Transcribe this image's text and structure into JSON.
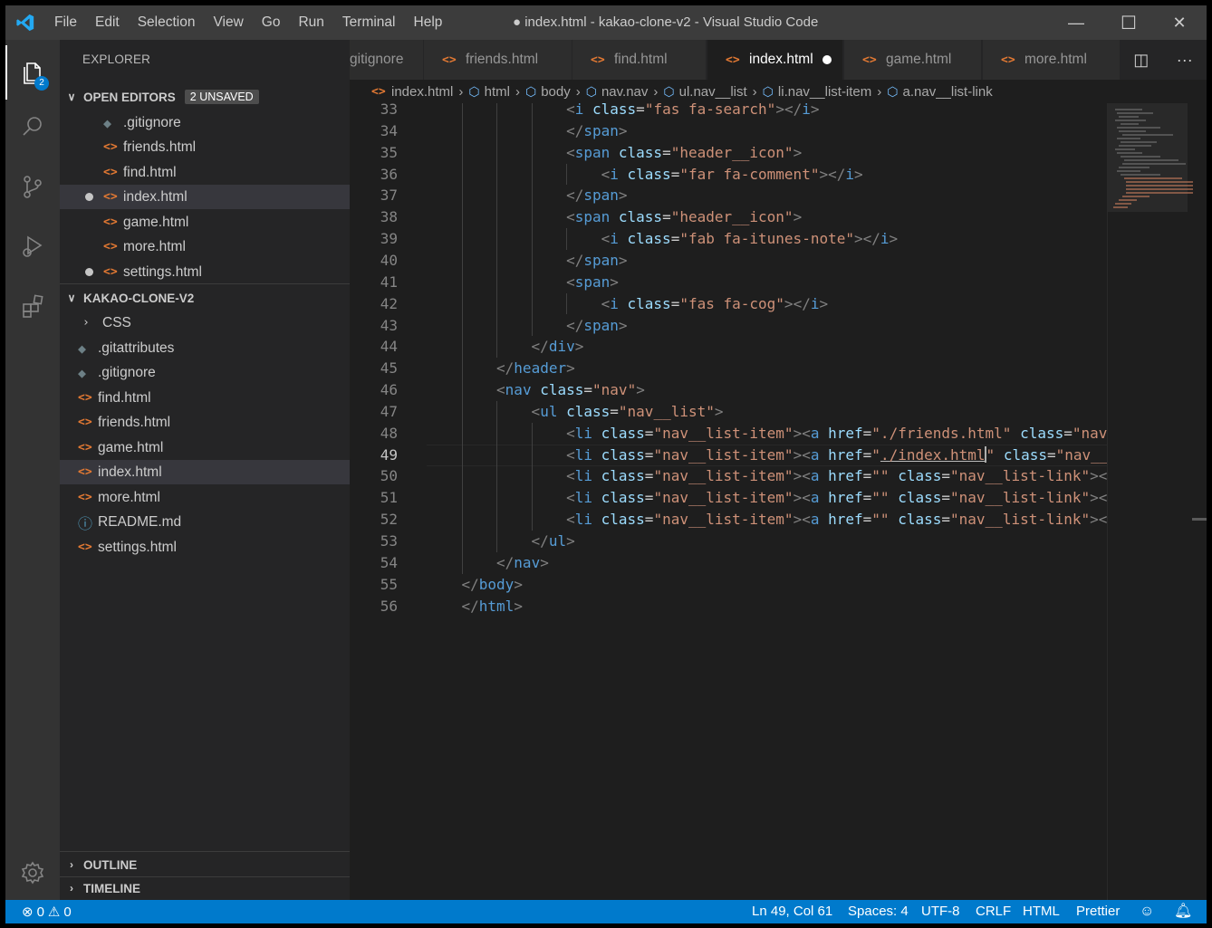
{
  "window": {
    "title": "● index.html - kakao-clone-v2 - Visual Studio Code",
    "minimize": "—",
    "maximize": "☐",
    "close": "✕"
  },
  "menu": [
    "File",
    "Edit",
    "Selection",
    "View",
    "Go",
    "Run",
    "Terminal",
    "Help"
  ],
  "activity": {
    "explorer_badge": "2",
    "icons": [
      "files-icon",
      "search-icon",
      "source-control-icon",
      "run-debug-icon",
      "extensions-icon",
      "settings-gear-icon"
    ]
  },
  "sidebar": {
    "title": "EXPLORER",
    "open_editors": {
      "label": "OPEN EDITORS",
      "badge": "2 UNSAVED",
      "items": [
        {
          "name": ".gitignore",
          "icon": "git-icon",
          "dirty": false
        },
        {
          "name": "friends.html",
          "icon": "html-icon",
          "dirty": false
        },
        {
          "name": "find.html",
          "icon": "html-icon",
          "dirty": false
        },
        {
          "name": "index.html",
          "icon": "html-icon",
          "dirty": true,
          "selected": true
        },
        {
          "name": "game.html",
          "icon": "html-icon",
          "dirty": false
        },
        {
          "name": "more.html",
          "icon": "html-icon",
          "dirty": false
        },
        {
          "name": "settings.html",
          "icon": "html-icon",
          "dirty": true
        }
      ]
    },
    "project": {
      "label": "KAKAO-CLONE-V2",
      "items": [
        {
          "name": "CSS",
          "icon": "folder-chevron-icon"
        },
        {
          "name": ".gitattributes",
          "icon": "git-icon"
        },
        {
          "name": ".gitignore",
          "icon": "git-icon"
        },
        {
          "name": "find.html",
          "icon": "html-icon"
        },
        {
          "name": "friends.html",
          "icon": "html-icon"
        },
        {
          "name": "game.html",
          "icon": "html-icon"
        },
        {
          "name": "index.html",
          "icon": "html-icon",
          "selected": true
        },
        {
          "name": "more.html",
          "icon": "html-icon"
        },
        {
          "name": "README.md",
          "icon": "info-icon"
        },
        {
          "name": "settings.html",
          "icon": "html-icon"
        }
      ]
    },
    "outline": "OUTLINE",
    "timeline": "TIMELINE"
  },
  "tabs": [
    {
      "label": "gitignore",
      "icon": "git-icon",
      "active": false
    },
    {
      "label": "friends.html",
      "icon": "html-icon",
      "active": false
    },
    {
      "label": "find.html",
      "icon": "html-icon",
      "active": false
    },
    {
      "label": "index.html",
      "icon": "html-icon",
      "active": true,
      "dirty": true
    },
    {
      "label": "game.html",
      "icon": "html-icon",
      "active": false
    },
    {
      "label": "more.html",
      "icon": "html-icon",
      "active": false
    }
  ],
  "breadcrumb": [
    "index.html",
    "html",
    "body",
    "nav.nav",
    "ul.nav__list",
    "li.nav__list-item",
    "a.nav__list-link"
  ],
  "editor": {
    "lines": [
      {
        "n": "33",
        "code": "<i class=\"fas fa-search\"></i>"
      },
      {
        "n": "34",
        "code": "</span>"
      },
      {
        "n": "35",
        "code": "<span class=\"header__icon\">"
      },
      {
        "n": "36",
        "code": "<i class=\"far fa-comment\"></i>"
      },
      {
        "n": "37",
        "code": "</span>"
      },
      {
        "n": "38",
        "code": "<span class=\"header__icon\">"
      },
      {
        "n": "39",
        "code": "<i class=\"fab fa-itunes-note\"></i>"
      },
      {
        "n": "40",
        "code": "</span>"
      },
      {
        "n": "41",
        "code": "<span>"
      },
      {
        "n": "42",
        "code": "<i class=\"fas fa-cog\"></i>"
      },
      {
        "n": "43",
        "code": "</span>"
      },
      {
        "n": "44",
        "code": "</div>"
      },
      {
        "n": "45",
        "code": "</header>"
      },
      {
        "n": "46",
        "code": "<nav class=\"nav\">"
      },
      {
        "n": "47",
        "code": "<ul class=\"nav__list\">"
      },
      {
        "n": "48",
        "code": "<li class=\"nav__list-item\"><a href=\"./friends.html\" class=\"nav__list"
      },
      {
        "n": "49",
        "code": "<li class=\"nav__list-item\"><a href=\"./index.html\" class=\"nav__list"
      },
      {
        "n": "50",
        "code": "<li class=\"nav__list-item\"><a href=\"\" class=\"nav__list-link\"></a></"
      },
      {
        "n": "51",
        "code": "<li class=\"nav__list-item\"><a href=\"\" class=\"nav__list-link\"></a></"
      },
      {
        "n": "52",
        "code": "<li class=\"nav__list-item\"><a href=\"\" class=\"nav__list-link\"></a></"
      },
      {
        "n": "53",
        "code": "</ul>"
      },
      {
        "n": "54",
        "code": "</nav>"
      },
      {
        "n": "55",
        "code": "</body>"
      },
      {
        "n": "56",
        "code": "</html>"
      }
    ]
  },
  "status": {
    "errors": "0",
    "warnings": "0",
    "position": "Ln 49, Col 61",
    "spaces": "Spaces: 4",
    "encoding": "UTF-8",
    "eol": "CRLF",
    "language": "HTML",
    "formatter": "Prettier"
  },
  "colors": {
    "accent": "#007acc",
    "tag": "#569cd6",
    "attribute": "#9cdcfe",
    "string": "#ce9178",
    "html_icon": "#e37933"
  }
}
